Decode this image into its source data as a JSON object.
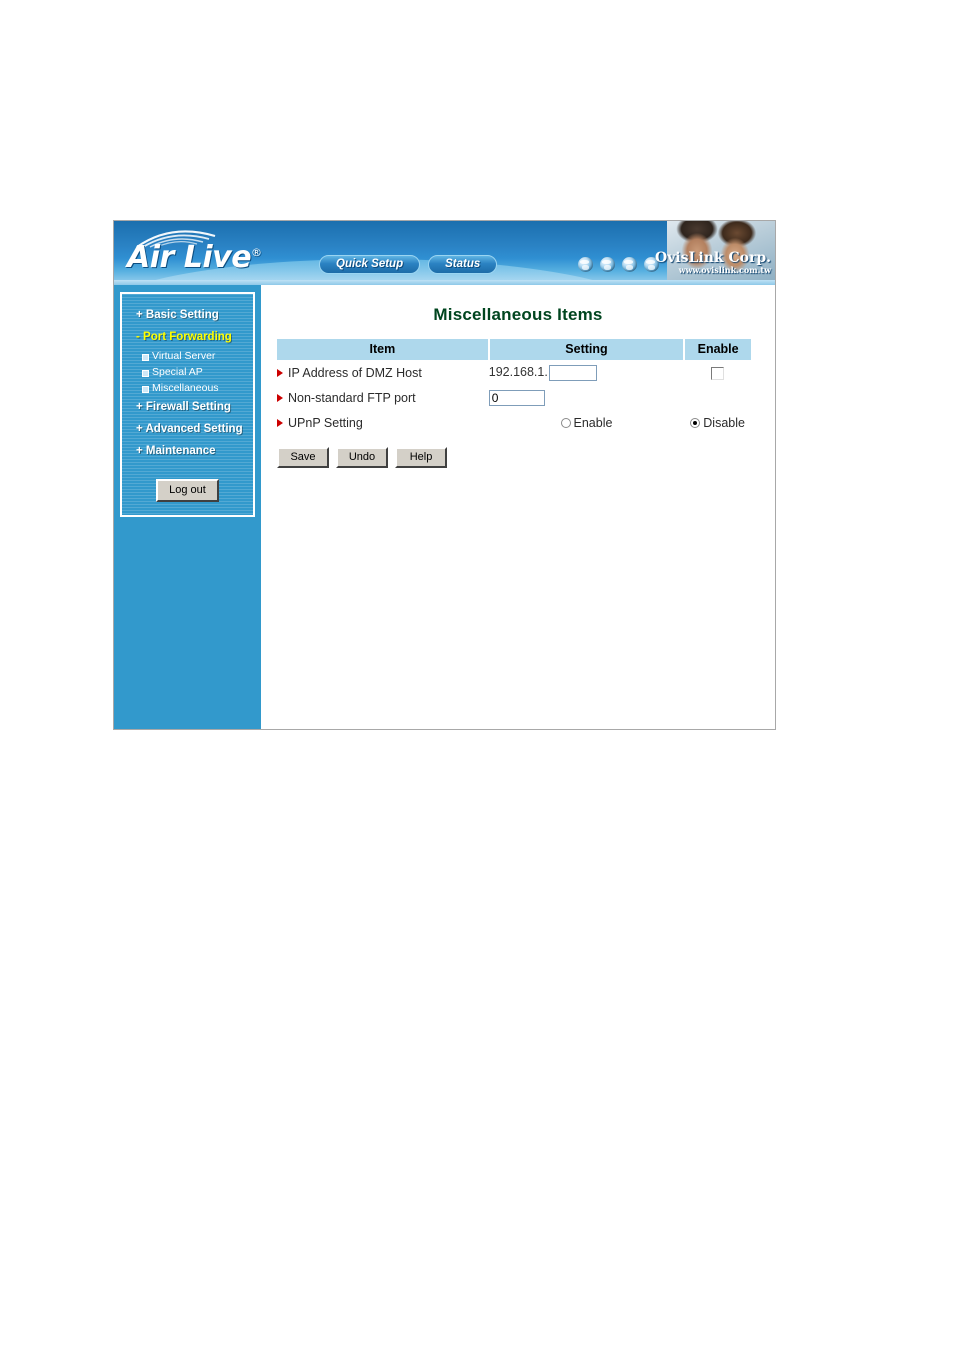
{
  "header": {
    "logo_text": "Air Live",
    "logo_registered_mark": "®",
    "nav_buttons": [
      {
        "label": "Quick Setup",
        "name": "quick-setup"
      },
      {
        "label": "Status",
        "name": "status"
      }
    ],
    "globe_icons": [
      "globe-icon-1",
      "globe-icon-2",
      "globe-icon-3",
      "globe-icon-4"
    ],
    "brand_name": "OvisLink Corp.",
    "brand_url": "www.ovislink.com.tw"
  },
  "sidebar": {
    "items": [
      {
        "label": "+ Basic Setting",
        "type": "top",
        "active": false
      },
      {
        "label": "- Port Forwarding",
        "type": "top",
        "active": true
      },
      {
        "label": "Virtual Server",
        "type": "sub",
        "active": false
      },
      {
        "label": "Special AP",
        "type": "sub",
        "active": false
      },
      {
        "label": "Miscellaneous",
        "type": "sub",
        "active": true
      },
      {
        "label": "+ Firewall Setting",
        "type": "top",
        "active": false
      },
      {
        "label": "+ Advanced Setting",
        "type": "top",
        "active": false
      },
      {
        "label": "+ Maintenance",
        "type": "top",
        "active": false
      }
    ],
    "logout_label": "Log out"
  },
  "main": {
    "title": "Miscellaneous Items",
    "table": {
      "headers": [
        "Item",
        "Setting",
        "Enable"
      ],
      "rows": [
        {
          "item": "IP Address of DMZ Host",
          "setting_prefix": "192.168.1.",
          "setting_value": "",
          "enable_checked": false
        },
        {
          "item": "Non-standard FTP port",
          "setting_value": "0"
        },
        {
          "item": "UPnP Setting",
          "option_enable": "Enable",
          "option_disable": "Disable",
          "selected": "Disable"
        }
      ]
    },
    "buttons": [
      {
        "label": "Save",
        "name": "save"
      },
      {
        "label": "Undo",
        "name": "undo"
      },
      {
        "label": "Help",
        "name": "help"
      }
    ]
  },
  "colors": {
    "sidebar_blue": "#3299cc",
    "table_header_blue": "#aed8ec",
    "title_green": "#00451f",
    "active_menu_yellow": "#ffff00",
    "bullet_red": "#cc0000"
  }
}
